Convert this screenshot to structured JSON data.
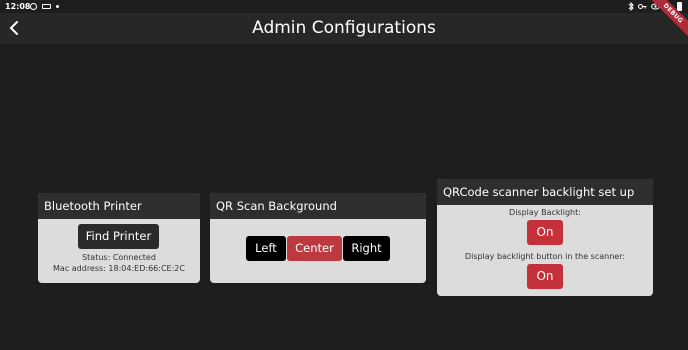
{
  "status_bar": {
    "time": "12:08",
    "left_icons": [
      "alarm-icon",
      "cast-icon",
      "notification-dot-icon"
    ],
    "right_icons": [
      "bluetooth-icon",
      "key-icon",
      "eye-icon",
      "wifi-icon",
      "battery-icon"
    ]
  },
  "app_bar": {
    "title": "Admin Configurations",
    "back_icon": "back-arrow-icon",
    "debug_banner": "DEBUG"
  },
  "bluetooth_card": {
    "title": "Bluetooth Printer",
    "find_button": "Find Printer",
    "status": "Status: Connected",
    "mac": "Mac address: 18:04:ED:66:CE:2C"
  },
  "qr_card": {
    "title": "QR Scan Background",
    "options": [
      "Left",
      "Center",
      "Right"
    ],
    "selected": "Center"
  },
  "backlight_card": {
    "title": "QRCode scanner backlight set up",
    "display_label": "Display Backlight:",
    "display_value": "On",
    "button_label": "Display backlight button in the scanner:",
    "button_value": "On"
  },
  "colors": {
    "background": "#1e1e1e",
    "accent_red": "#c4313a",
    "card_header": "#2d2e2f",
    "card_body": "#dcdcdc"
  }
}
